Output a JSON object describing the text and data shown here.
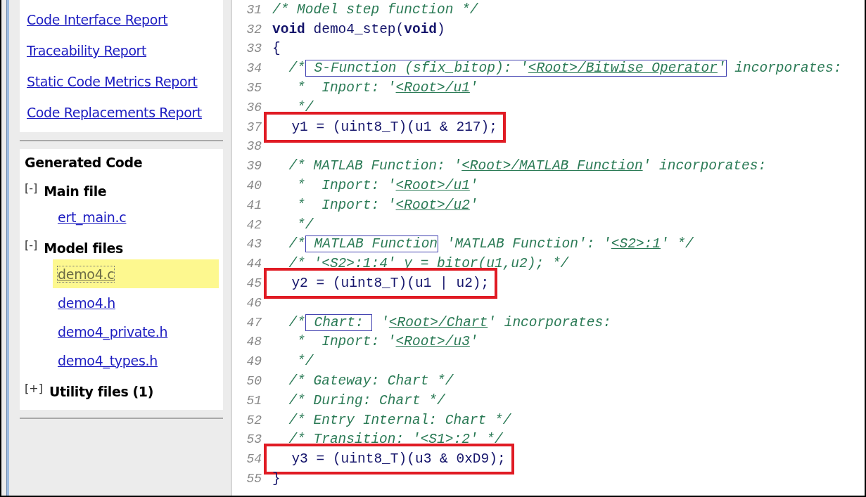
{
  "report_links": [
    {
      "label": "Code Interface Report"
    },
    {
      "label": "Traceability Report"
    },
    {
      "label": "Static Code Metrics Report"
    },
    {
      "label": "Code Replacements Report"
    }
  ],
  "generated_code": {
    "title": "Generated Code",
    "groups": [
      {
        "toggle": "[-]",
        "label": "Main file",
        "files": [
          {
            "name": "ert_main.c",
            "selected": false
          }
        ]
      },
      {
        "toggle": "[-]",
        "label": "Model files",
        "files": [
          {
            "name": "demo4.c",
            "selected": true
          },
          {
            "name": "demo4.h",
            "selected": false
          },
          {
            "name": "demo4_private.h",
            "selected": false
          },
          {
            "name": "demo4_types.h",
            "selected": false
          }
        ]
      },
      {
        "toggle": "[+]",
        "label": "Utility files (1)"
      }
    ]
  },
  "code_lines": [
    {
      "number": "31",
      "highlighted": false,
      "segments": [
        {
          "kind": "comment",
          "text": "/* Model step function */"
        }
      ]
    },
    {
      "number": "32",
      "highlighted": false,
      "segments": [
        {
          "kind": "keyword",
          "text": "void"
        },
        {
          "kind": "plain",
          "text": " demo4_step("
        },
        {
          "kind": "keyword",
          "text": "void"
        },
        {
          "kind": "plain",
          "text": ")"
        }
      ]
    },
    {
      "number": "33",
      "highlighted": false,
      "segments": [
        {
          "kind": "plain",
          "text": "{"
        }
      ]
    },
    {
      "number": "34",
      "highlighted": false,
      "segments": [
        {
          "kind": "comment",
          "text": "  /*"
        },
        {
          "kind": "box",
          "parts": [
            {
              "kind": "comment",
              "text": " S-Function (sfix_bitop): '"
            },
            {
              "kind": "link",
              "text": "<Root>/Bitwise Operator"
            },
            {
              "kind": "comment",
              "text": "'"
            }
          ]
        },
        {
          "kind": "comment",
          "text": " incorporates:"
        }
      ]
    },
    {
      "number": "35",
      "highlighted": false,
      "segments": [
        {
          "kind": "comment",
          "text": "   *  Inport: '"
        },
        {
          "kind": "link",
          "text": "<Root>/u1"
        },
        {
          "kind": "comment",
          "text": "'"
        }
      ]
    },
    {
      "number": "36",
      "highlighted": false,
      "segments": [
        {
          "kind": "comment",
          "text": "   */"
        }
      ]
    },
    {
      "number": "37",
      "highlighted": true,
      "segments": [
        {
          "kind": "plain",
          "text": "  y1 = (uint8_T)(u1 & 217);"
        }
      ]
    },
    {
      "number": "38",
      "highlighted": false
    },
    {
      "number": "39",
      "highlighted": false,
      "segments": [
        {
          "kind": "comment",
          "text": "  /* MATLAB Function: '"
        },
        {
          "kind": "link",
          "text": "<Root>/MATLAB Function"
        },
        {
          "kind": "comment",
          "text": "' incorporates:"
        }
      ]
    },
    {
      "number": "40",
      "highlighted": false,
      "segments": [
        {
          "kind": "comment",
          "text": "   *  Inport: '"
        },
        {
          "kind": "link",
          "text": "<Root>/u1"
        },
        {
          "kind": "comment",
          "text": "'"
        }
      ]
    },
    {
      "number": "41",
      "highlighted": false,
      "segments": [
        {
          "kind": "comment",
          "text": "   *  Inport: '"
        },
        {
          "kind": "link",
          "text": "<Root>/u2"
        },
        {
          "kind": "comment",
          "text": "'"
        }
      ]
    },
    {
      "number": "42",
      "highlighted": false,
      "segments": [
        {
          "kind": "comment",
          "text": "   */"
        }
      ]
    },
    {
      "number": "43",
      "highlighted": false,
      "segments": [
        {
          "kind": "comment",
          "text": "  /*"
        },
        {
          "kind": "box",
          "parts": [
            {
              "kind": "comment",
              "text": " MATLAB Function"
            }
          ]
        },
        {
          "kind": "comment",
          "text": " 'MATLAB Function': '"
        },
        {
          "kind": "link",
          "text": "<S2>:1"
        },
        {
          "kind": "comment",
          "text": "' */"
        }
      ]
    },
    {
      "number": "44",
      "highlighted": false,
      "segments": [
        {
          "kind": "comment",
          "text": "  /* '"
        },
        {
          "kind": "link",
          "text": "<S2>:1:4"
        },
        {
          "kind": "comment",
          "text": "' y = bitor(u1,u2); */"
        }
      ]
    },
    {
      "number": "45",
      "highlighted": true,
      "segments": [
        {
          "kind": "plain",
          "text": "  y2 = (uint8_T)(u1 | u2);"
        }
      ]
    },
    {
      "number": "46",
      "highlighted": false
    },
    {
      "number": "47",
      "highlighted": false,
      "segments": [
        {
          "kind": "comment",
          "text": "  /*"
        },
        {
          "kind": "box",
          "parts": [
            {
              "kind": "comment",
              "text": " Chart: "
            }
          ]
        },
        {
          "kind": "comment",
          "text": " '"
        },
        {
          "kind": "link",
          "text": "<Root>/Chart"
        },
        {
          "kind": "comment",
          "text": "' incorporates:"
        }
      ]
    },
    {
      "number": "48",
      "highlighted": false,
      "segments": [
        {
          "kind": "comment",
          "text": "   *  Inport: '"
        },
        {
          "kind": "link",
          "text": "<Root>/u3"
        },
        {
          "kind": "comment",
          "text": "'"
        }
      ]
    },
    {
      "number": "49",
      "highlighted": false,
      "segments": [
        {
          "kind": "comment",
          "text": "   */"
        }
      ]
    },
    {
      "number": "50",
      "highlighted": false,
      "segments": [
        {
          "kind": "comment",
          "text": "  /* Gateway: Chart */"
        }
      ]
    },
    {
      "number": "51",
      "highlighted": false,
      "segments": [
        {
          "kind": "comment",
          "text": "  /* During: Chart */"
        }
      ]
    },
    {
      "number": "52",
      "highlighted": false,
      "segments": [
        {
          "kind": "comment",
          "text": "  /* Entry Internal: Chart */"
        }
      ]
    },
    {
      "number": "53",
      "highlighted": false,
      "segments": [
        {
          "kind": "comment",
          "text": "  /* Transition: '"
        },
        {
          "kind": "link",
          "text": "<S1>:2"
        },
        {
          "kind": "comment",
          "text": "' */"
        }
      ]
    },
    {
      "number": "54",
      "highlighted": true,
      "segments": [
        {
          "kind": "plain",
          "text": "  y3 = (uint8_T)(u3 & 0xD9);"
        }
      ]
    },
    {
      "number": "55",
      "highlighted": false,
      "segments": [
        {
          "kind": "plain",
          "text": "}"
        }
      ]
    }
  ]
}
